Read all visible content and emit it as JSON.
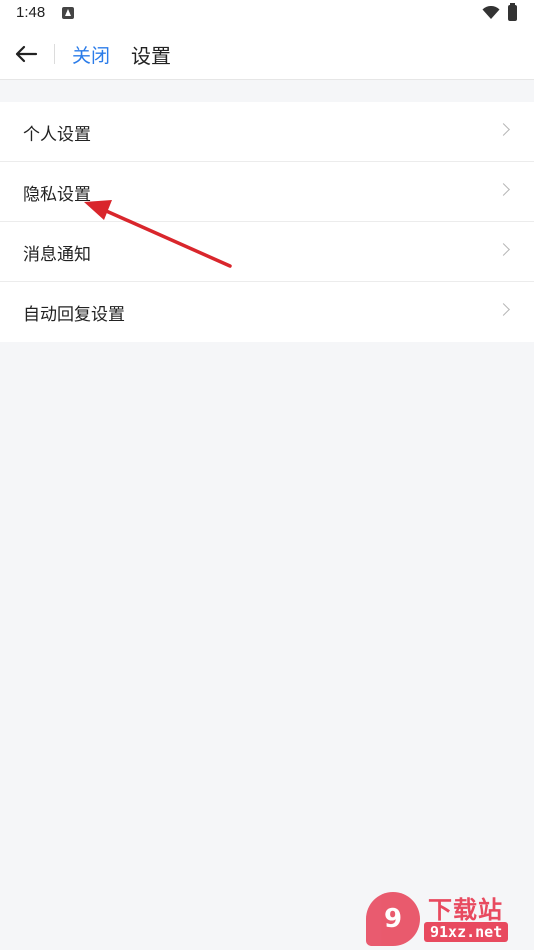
{
  "status_bar": {
    "time": "1:48",
    "notification_icon": "android-a-icon",
    "wifi_icon": "wifi-icon",
    "battery_icon": "battery-charging-icon"
  },
  "nav": {
    "back_icon": "arrow-left-icon",
    "close_label": "关闭",
    "title": "设置"
  },
  "settings": {
    "items": [
      {
        "label": "个人设置"
      },
      {
        "label": "隐私设置"
      },
      {
        "label": "消息通知"
      },
      {
        "label": "自动回复设置"
      }
    ]
  },
  "watermark": {
    "logo_text": "9",
    "title": "下载站",
    "domain": "91xz.net"
  },
  "colors": {
    "accent": "#2b7ce9",
    "annotation": "#d9262c",
    "background": "#f5f6f8",
    "watermark": "#e84a5f"
  }
}
